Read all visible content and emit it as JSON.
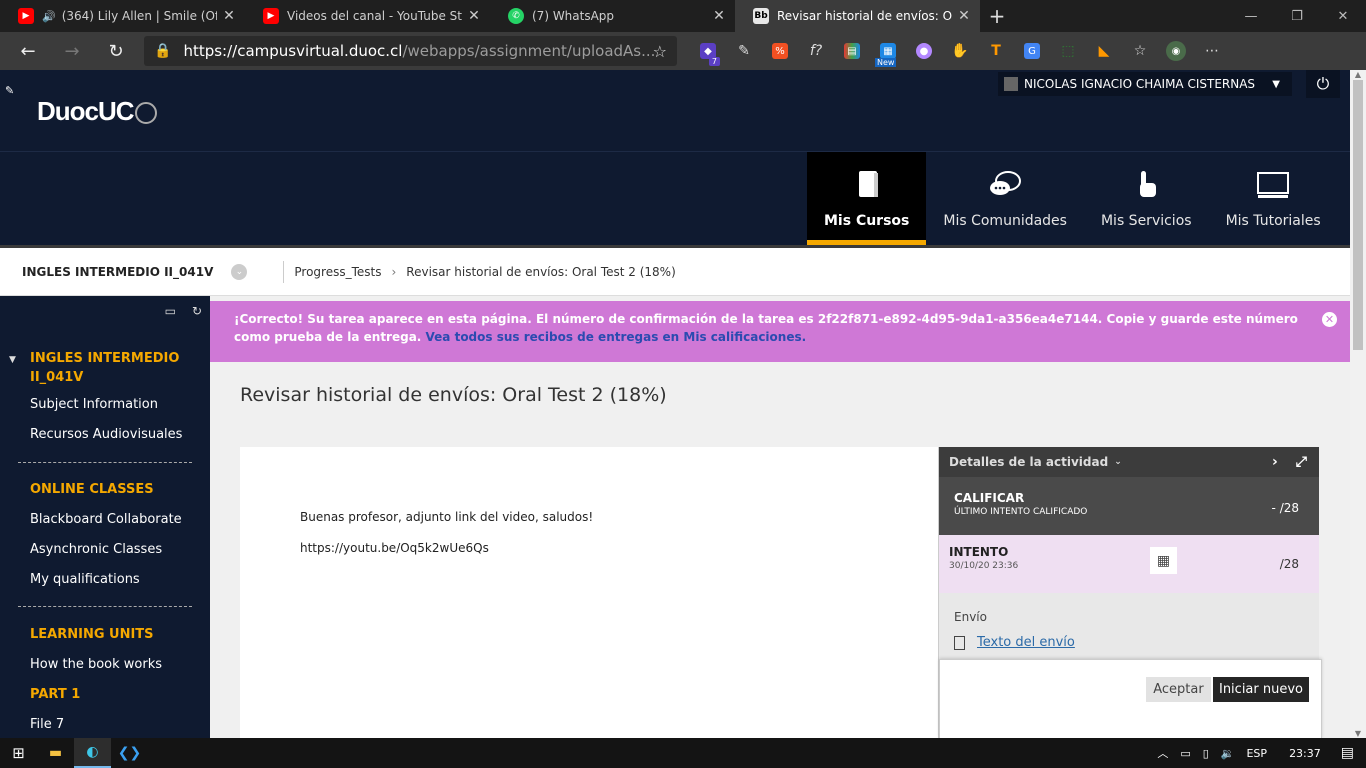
{
  "browser": {
    "tabs": [
      {
        "title": "(364) Lily Allen | Smile (Offic",
        "icon": "youtube-icon",
        "color": "#ff0000",
        "audio": true
      },
      {
        "title": "Videos del canal - YouTube Studi",
        "icon": "youtube-icon",
        "color": "#ff0000"
      },
      {
        "title": "(7) WhatsApp",
        "icon": "whatsapp-icon",
        "color": "#25d366"
      },
      {
        "title": "Revisar historial de envíos: Oral T",
        "icon": "blackboard-icon",
        "color": "#e8e8e8",
        "active": true
      }
    ],
    "url_host": "https://campusvirtual.duoc.cl",
    "url_path": "/webapps/assignment/uploadAs...",
    "ext_badge": "7",
    "ext_new": "New"
  },
  "header": {
    "logo": "DuocUC",
    "user_name": "NICOLAS IGNACIO CHAIMA CISTERNAS",
    "menu": [
      {
        "label": "Mis Cursos",
        "active": true
      },
      {
        "label": "Mis Comunidades"
      },
      {
        "label": "Mis Servicios"
      },
      {
        "label": "Mis Tutoriales"
      }
    ]
  },
  "breadcrumb": {
    "course": "INGLES INTERMEDIO II_041V",
    "items": [
      "Progress_Tests",
      "Revisar historial de envíos: Oral Test 2 (18%)"
    ]
  },
  "sidebar": {
    "items": [
      {
        "label": "INGLES INTERMEDIO II_041V",
        "heading": true
      },
      {
        "label": "Subject Information"
      },
      {
        "label": "Recursos Audiovisuales"
      },
      {
        "label": "ONLINE CLASSES",
        "heading": true
      },
      {
        "label": "Blackboard Collaborate"
      },
      {
        "label": "Asynchronic Classes"
      },
      {
        "label": "My qualifications"
      },
      {
        "label": "LEARNING UNITS",
        "heading": true
      },
      {
        "label": "How the book works"
      },
      {
        "label": "PART 1",
        "heading": true
      },
      {
        "label": "File 7"
      }
    ]
  },
  "alert": {
    "text": "¡Correcto! Su tarea aparece en esta página. El número de confirmación de la tarea es 2f22f871-e892-4d95-9da1-a356ea4e7144. Copie y guarde este número como prueba de la entrega. ",
    "link": "Vea todos sus recibos de entregas en Mis calificaciones."
  },
  "page": {
    "title": "Revisar historial de envíos: Oral Test 2 (18%)",
    "submission_text": "Buenas profesor, adjunto link del video, saludos!",
    "submission_link": "https://youtu.be/Oq5k2wUe6Qs"
  },
  "panel": {
    "details": "Detalles de la actividad",
    "grade_title": "CALIFICAR",
    "grade_sub": "ÚLTIMO INTENTO CALIFICADO",
    "grade_value": "-",
    "grade_max": "/28",
    "attempt_title": "INTENTO",
    "attempt_date": "30/10/20 23:36",
    "attempt_max": "/28",
    "envio_label": "Envío",
    "envio_link": "Texto del envío",
    "btn_accept": "Aceptar",
    "btn_new": "Iniciar nuevo"
  },
  "taskbar": {
    "lang": "ESP",
    "time": "23:37"
  }
}
